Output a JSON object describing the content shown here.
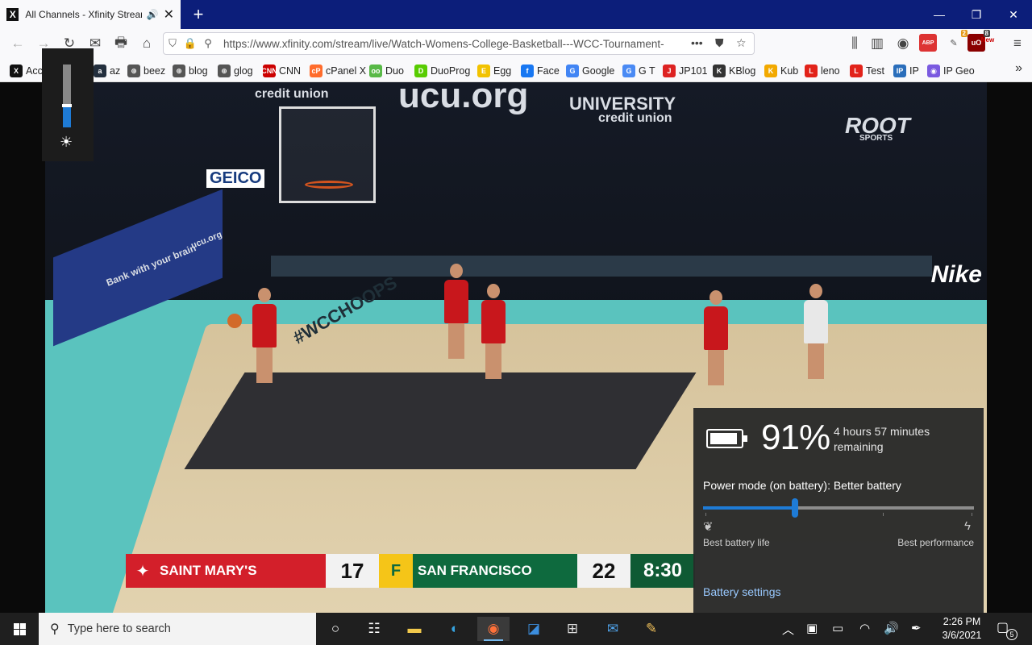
{
  "browser": {
    "tab": {
      "favicon": "X",
      "title": "All Channels - Xfinity Stream",
      "speaker_icon": "speaker-icon",
      "close_icon": "close-icon"
    },
    "new_tab": "+",
    "window_controls": {
      "minimize": "—",
      "restore": "❐",
      "close": "✕"
    },
    "nav": {
      "back": "←",
      "forward": "→",
      "reload": "↻",
      "mail": "✉",
      "print": "🖶",
      "home": "⌂"
    },
    "url": "https://www.xfinity.com/stream/live/Watch-Womens-College-Basketball---WCC-Tournament-",
    "url_menu": "•••",
    "extensions": [
      {
        "label": "ABP",
        "color": "#d33"
      },
      {
        "label": "2",
        "color": "#e59a1a"
      },
      {
        "label": "8",
        "color": "#8a0000"
      },
      {
        "label": "New",
        "color": "#c00"
      }
    ],
    "menu": "≡"
  },
  "bookmarks": [
    {
      "icon_text": "X",
      "color": "#111",
      "label": "Acc"
    },
    {
      "icon_text": "a",
      "color": "#232f3e",
      "label": "az"
    },
    {
      "icon_text": "⊕",
      "color": "#555",
      "label": "beez"
    },
    {
      "icon_text": "⊕",
      "color": "#555",
      "label": "blog"
    },
    {
      "icon_text": "⊕",
      "color": "#555",
      "label": "glog"
    },
    {
      "icon_text": "CNN",
      "color": "#c00",
      "label": "CNN"
    },
    {
      "icon_text": "cP",
      "color": "#ff6c2c",
      "label": "cPanel X"
    },
    {
      "icon_text": "oo",
      "color": "#58b947",
      "label": "Duo"
    },
    {
      "icon_text": "D",
      "color": "#58cc02",
      "label": "DuoProg"
    },
    {
      "icon_text": "E",
      "color": "#f2c200",
      "label": "Egg"
    },
    {
      "icon_text": "f",
      "color": "#1877f2",
      "label": "Face"
    },
    {
      "icon_text": "G",
      "color": "#4285f4",
      "label": "Google"
    },
    {
      "icon_text": "G",
      "color": "#4a8af4",
      "label": "G T"
    },
    {
      "icon_text": "J",
      "color": "#d22",
      "label": "JP101"
    },
    {
      "icon_text": "K",
      "color": "#333",
      "label": "KBlog"
    },
    {
      "icon_text": "K",
      "color": "#f2a900",
      "label": "Kub"
    },
    {
      "icon_text": "L",
      "color": "#e2231a",
      "label": "leno"
    },
    {
      "icon_text": "L",
      "color": "#e2231a",
      "label": "Test"
    },
    {
      "icon_text": "IP",
      "color": "#2a6ebb",
      "label": "IP"
    },
    {
      "icon_text": "◉",
      "color": "#7a5ae0",
      "label": "IP Geo"
    }
  ],
  "bookmarks_more": "»",
  "video": {
    "wall_texts": [
      "ucu.org",
      "credit union",
      "UNIVERSITY",
      "credit union",
      "ROOT",
      "SPORTS",
      "GEICO",
      "Nike",
      "#WCCHOOPS",
      "Bank with your brain",
      "ucu.org"
    ],
    "scoreboard": {
      "team1": "SAINT MARY'S",
      "score1": "17",
      "team2": "SAN FRANCISCO",
      "score2": "22",
      "clock": "8:30"
    }
  },
  "brightness_osd": {
    "level": 0.35,
    "sun_icon": "☀"
  },
  "battery": {
    "percent": "91%",
    "level": 0.91,
    "remaining": "4 hours 57 minutes remaining",
    "mode": "Power mode (on battery): Better battery",
    "slider_position": 0.34,
    "left_label": "Best battery life",
    "right_label": "Best performance",
    "settings_link": "Battery settings"
  },
  "taskbar": {
    "search_placeholder": "Type here to search",
    "apps": [
      "cortana-icon",
      "task-view-icon",
      "file-explorer-icon",
      "edge-icon",
      "firefox-icon",
      "outlook-icon",
      "store-icon",
      "mail-icon",
      "paint-icon"
    ],
    "tray": [
      "chevron-up-icon",
      "meet-now-icon",
      "battery-icon",
      "wifi-icon",
      "volume-icon",
      "pen-icon"
    ],
    "time": "2:26 PM",
    "date": "3/6/2021",
    "notifications": "5"
  }
}
